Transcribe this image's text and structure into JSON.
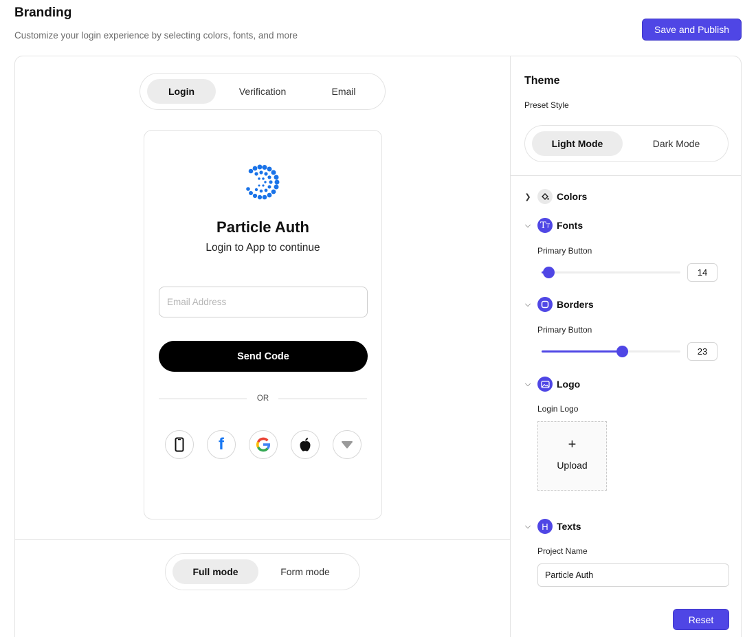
{
  "header": {
    "title": "Branding",
    "subtitle": "Customize your login experience by selecting colors, fonts, and more",
    "save_label": "Save and Publish"
  },
  "preview": {
    "tabs": [
      {
        "label": "Login",
        "active": true
      },
      {
        "label": "Verification",
        "active": false
      },
      {
        "label": "Email",
        "active": false
      }
    ],
    "card": {
      "logo_icon": "particle-spiral-logo",
      "title": "Particle Auth",
      "subtitle": "Login to App to continue",
      "email_placeholder": "Email Address",
      "email_value": "",
      "send_label": "Send Code",
      "or_label": "OR",
      "socials": [
        "phone-icon",
        "facebook-icon",
        "google-icon",
        "apple-icon",
        "more-icon"
      ]
    },
    "modes": [
      {
        "label": "Full mode",
        "active": true
      },
      {
        "label": "Form mode",
        "active": false
      }
    ]
  },
  "theme": {
    "title": "Theme",
    "preset_label": "Preset Style",
    "presets": [
      {
        "label": "Light Mode",
        "active": true
      },
      {
        "label": "Dark Mode",
        "active": false
      }
    ],
    "sections": {
      "colors": {
        "label": "Colors",
        "expanded": false,
        "icon": "paint-bucket-icon"
      },
      "fonts": {
        "label": "Fonts",
        "expanded": true,
        "icon": "text-size-icon",
        "sub_label": "Primary Button",
        "value": "14",
        "slider_fraction": 0.05
      },
      "borders": {
        "label": "Borders",
        "expanded": true,
        "icon": "border-radius-icon",
        "sub_label": "Primary Button",
        "value": "23",
        "slider_fraction": 0.58
      },
      "logo": {
        "label": "Logo",
        "expanded": true,
        "icon": "image-icon",
        "sub_label": "Login Logo",
        "upload_plus": "+",
        "upload_label": "Upload"
      },
      "texts": {
        "label": "Texts",
        "expanded": true,
        "icon": "heading-icon",
        "icon_glyph": "H",
        "sub_label": "Project Name",
        "value": "Particle Auth"
      }
    },
    "reset_label": "Reset"
  },
  "colors": {
    "accent": "#4f46e5",
    "text": "#111111",
    "muted": "#6b6b6b",
    "border": "#e3e3e3"
  }
}
